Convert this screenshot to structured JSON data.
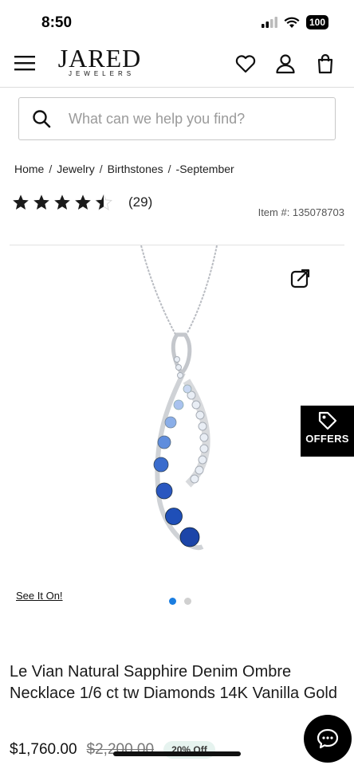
{
  "status": {
    "time": "8:50",
    "battery": "100"
  },
  "header": {
    "logo_main": "JARED",
    "logo_sub": "JEWELERS",
    "icons": [
      "menu-icon",
      "heart-icon",
      "account-icon",
      "bag-icon"
    ]
  },
  "search": {
    "placeholder": "What can we help you find?"
  },
  "breadcrumb": {
    "items": [
      "Home",
      "Jewelry",
      "Birthstones",
      "-September"
    ],
    "separator": "/"
  },
  "rating": {
    "value": 4.5,
    "max": 5,
    "review_count": "(29)"
  },
  "item_number": "Item #: 135078703",
  "gallery": {
    "see_it_on": "See It On!",
    "total_slides": 2,
    "active_slide": 1
  },
  "offers": {
    "label": "OFFERS"
  },
  "product": {
    "title": "Le Vian Natural Sapphire Denim Ombre Necklace 1/6 ct tw Diamonds 14K Vanilla Gold",
    "price": "$1,760.00",
    "original_price": "$2,200.00",
    "discount": "20% Off"
  },
  "colors": {
    "accent_dot": "#1a7de0",
    "sapphire": "#1f4fb8",
    "offers_bg": "#000000"
  }
}
